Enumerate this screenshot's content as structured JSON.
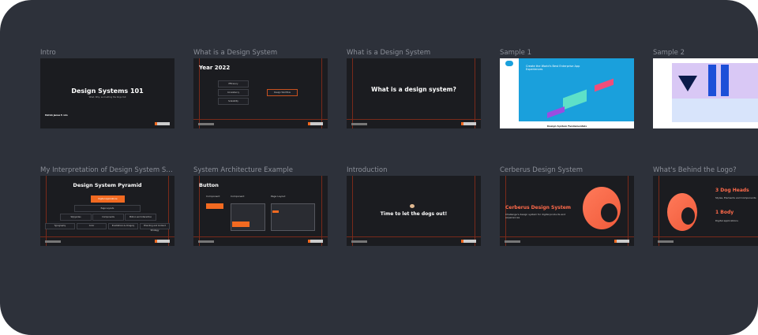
{
  "slides": [
    {
      "label": "Intro",
      "title": "Design Systems 101",
      "subtitle": "What, Why, and Letting the Dogs Out",
      "author": "Patrick James E. Lim"
    },
    {
      "label": "What is a Design System",
      "title": "Year 2022",
      "items": [
        "Efficiency",
        "Consistency",
        "Scalability"
      ],
      "target": "Design Workflow"
    },
    {
      "label": "What is a Design System",
      "title": "What is a design system?"
    },
    {
      "label": "Sample 1",
      "headline": "Create the World's Best Enterprise App Experiences",
      "caption": "Design System Fundamentals"
    },
    {
      "label": "Sample 2"
    },
    {
      "label": "My Interpretation of Design System Structure",
      "title": "Design System Pyramid",
      "top": "Digital Applications",
      "level2": "Page Layouts",
      "level3": [
        "Stylguides",
        "Components",
        "Motion and Interaction"
      ],
      "level4": [
        "Typography",
        "Color",
        "Illustrations & Imagery",
        "Branding and Content Strategy"
      ]
    },
    {
      "label": "System Architecture Example",
      "title": "Button",
      "columns": [
        "Component",
        "Component",
        "Page Layout"
      ]
    },
    {
      "label": "Introduction",
      "title": "Time to let the dogs out!"
    },
    {
      "label": "Cerberus Design System",
      "title": "Cerberus Design System",
      "subtitle": "Challenge's design system for digital products and experiences"
    },
    {
      "label": "What's Behind the Logo?",
      "h1": "3 Dog Heads",
      "p1": "Styles, Elements and Components",
      "h2": "1 Body",
      "p2": "Digital applications"
    }
  ],
  "colors": {
    "background": "#2d313a",
    "slide": "#1b1c20",
    "accent": "#f26a21",
    "logo_gradient": "#ff7a5a"
  }
}
